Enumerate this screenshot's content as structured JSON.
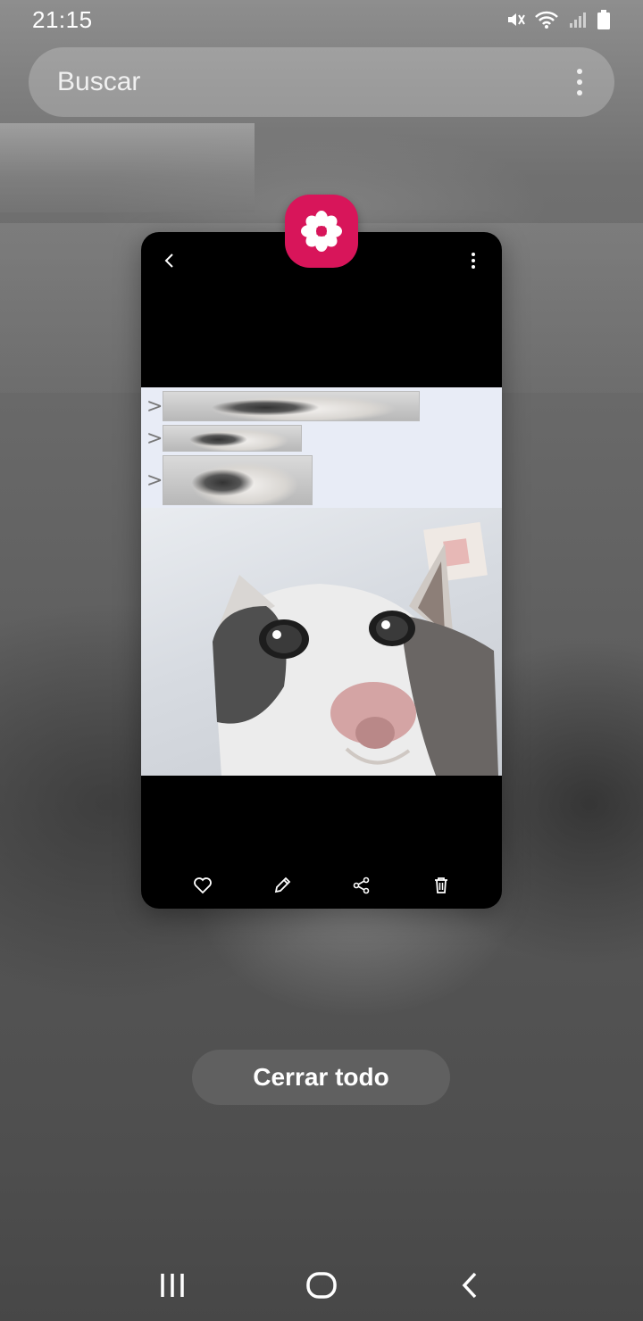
{
  "status_bar": {
    "time": "21:15",
    "icons": [
      "mute-icon",
      "wifi-icon",
      "signal-icon",
      "battery-icon"
    ]
  },
  "search": {
    "placeholder": "Buscar",
    "menu_icon": "more-vert-icon"
  },
  "recent_app": {
    "app_icon": "gallery-flower-icon",
    "app_icon_color": "#d8155a",
    "top_controls": [
      "back-icon",
      "more-vert-icon"
    ],
    "meme_rows": [
      {
        "arrow": ">"
      },
      {
        "arrow": ">"
      },
      {
        "arrow": ">"
      }
    ],
    "actions": [
      "heart-icon",
      "pencil-icon",
      "share-icon",
      "trash-icon"
    ]
  },
  "close_all": {
    "label": "Cerrar todo"
  },
  "nav_bar": {
    "buttons": [
      "recents-icon",
      "home-icon",
      "back-icon"
    ]
  }
}
